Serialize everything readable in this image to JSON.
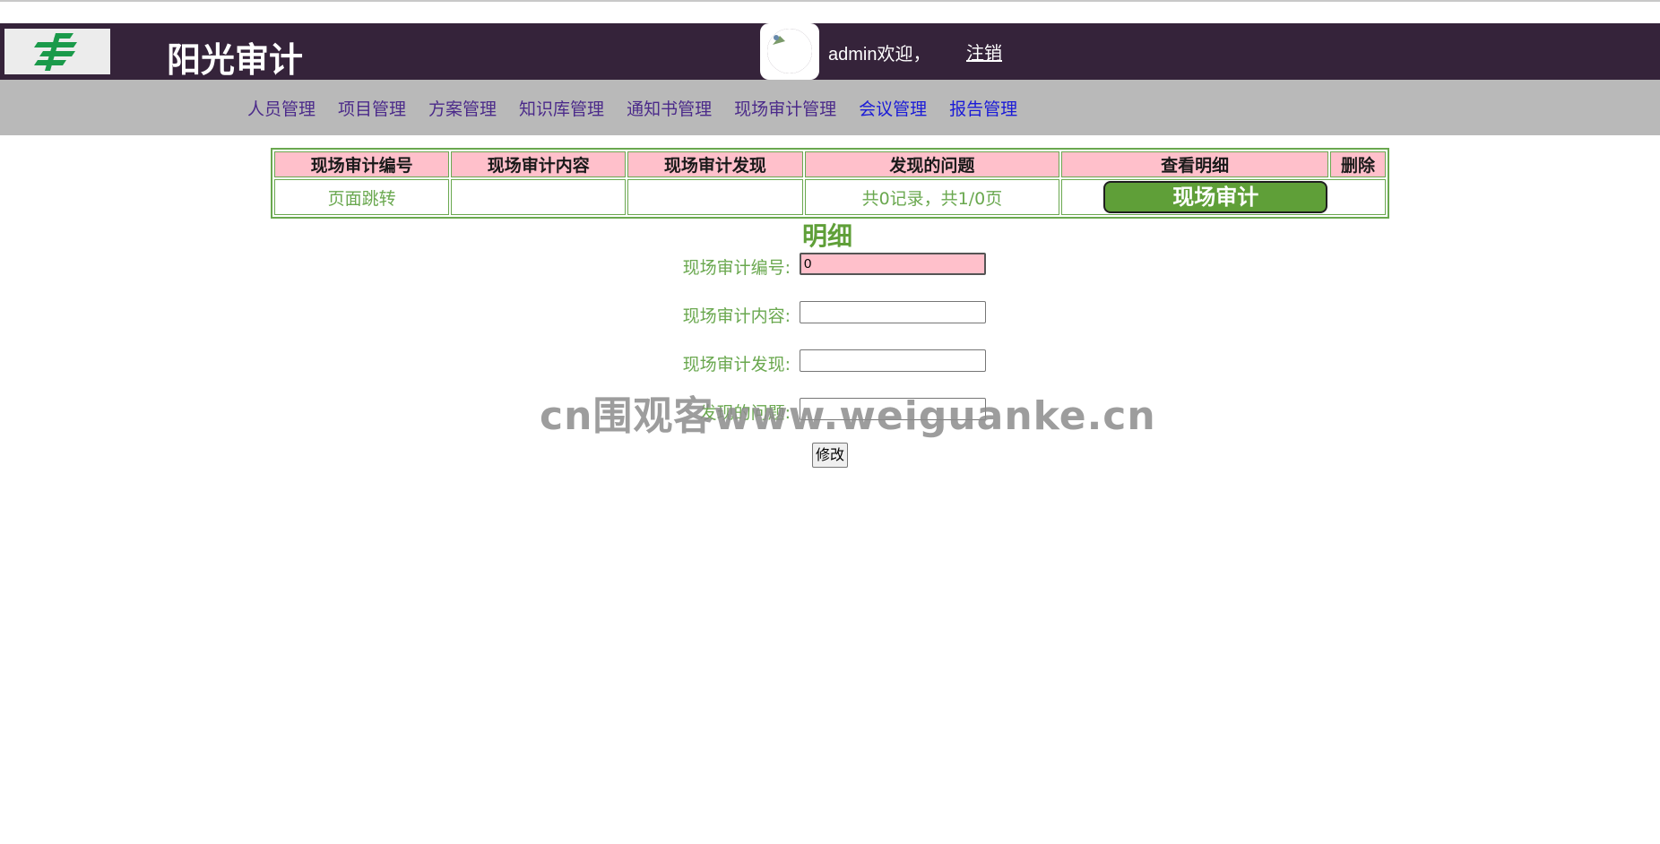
{
  "header": {
    "title": "阳光审计",
    "welcome": "admin欢迎，",
    "logout": "注销",
    "colors": {
      "header_bg": "#35233a",
      "nav_bg": "#b9b9b9"
    }
  },
  "nav": {
    "items": [
      {
        "label": "人员管理"
      },
      {
        "label": "项目管理"
      },
      {
        "label": "方案管理"
      },
      {
        "label": "知识库管理"
      },
      {
        "label": "通知书管理"
      },
      {
        "label": "现场审计管理"
      },
      {
        "label": "会议管理"
      },
      {
        "label": "报告管理"
      }
    ]
  },
  "table": {
    "headers": [
      "现场审计编号",
      "现场审计内容",
      "现场审计发现",
      "发现的问题",
      "查看明细",
      "删除"
    ],
    "row": {
      "page_jump": "页面跳转",
      "pagination": "共0记录，共1/0页",
      "action_button": "现场审计"
    }
  },
  "detail": {
    "title": "明细",
    "fields": [
      {
        "label": "现场审计编号:",
        "value": "0"
      },
      {
        "label": "现场审计内容:",
        "value": ""
      },
      {
        "label": "现场审计发现:",
        "value": ""
      },
      {
        "label": "发现的问题:",
        "value": ""
      }
    ],
    "submit": "修改"
  },
  "watermark": "cn围观客www.weiguanke.cn"
}
